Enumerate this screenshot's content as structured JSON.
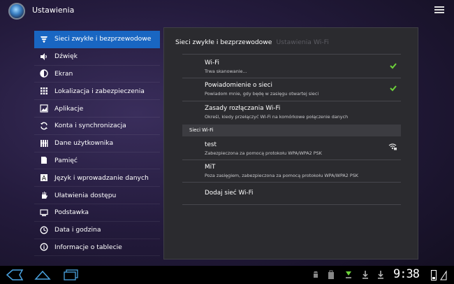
{
  "app": {
    "title": "Ustawienia"
  },
  "sidebar": {
    "items": [
      {
        "label": "Sieci zwykłe i bezprzewodowe",
        "icon": "wifi-icon",
        "active": true
      },
      {
        "label": "Dźwięk",
        "icon": "speaker-icon"
      },
      {
        "label": "Ekran",
        "icon": "brightness-icon"
      },
      {
        "label": "Lokalizacja i zabezpieczenia",
        "icon": "grid-lock-icon"
      },
      {
        "label": "Aplikacje",
        "icon": "apps-icon"
      },
      {
        "label": "Konta i synchronizacja",
        "icon": "sync-icon"
      },
      {
        "label": "Dane użytkownika",
        "icon": "data-icon"
      },
      {
        "label": "Pamięć",
        "icon": "storage-icon"
      },
      {
        "label": "Język i wprowadzanie danych",
        "icon": "language-icon"
      },
      {
        "label": "Ułatwienia dostępu",
        "icon": "hand-icon"
      },
      {
        "label": "Podstawka",
        "icon": "dock-icon"
      },
      {
        "label": "Data i godzina",
        "icon": "clock-icon"
      },
      {
        "label": "Informacje o tablecie",
        "icon": "info-icon"
      }
    ]
  },
  "panel": {
    "breadcrumb_active": "Sieci zwykłe i bezprzewodowe",
    "breadcrumb_inactive": "Ustawienia Wi-Fi",
    "wifi": {
      "title": "Wi-Fi",
      "subtitle": "Trwa skanowanie...",
      "checked": true
    },
    "notify": {
      "title": "Powiadomienie o sieci",
      "subtitle": "Powiadom mnie, gdy będę w zasięgu otwartej sieci",
      "checked": true
    },
    "sleep": {
      "title": "Zasady rozłączania Wi-Fi",
      "subtitle": "Określ, kiedy przełączyć Wi-Fi na komórkowe połączenie danych"
    },
    "section_header": "Sieci Wi-Fi",
    "networks": [
      {
        "name": "test",
        "status": "Zabezpieczona za pomocą protokołu WPA/WPA2 PSK"
      },
      {
        "name": "MiT",
        "status": "Poza zasięgiem, zabezpieczona za pomocą protokołu WPA/WPA2 PSK"
      }
    ],
    "add_network": "Dodaj sieć Wi-Fi"
  },
  "statusbar": {
    "clock": "9:38"
  },
  "colors": {
    "accent": "#1966c2",
    "check": "#6dd33a"
  }
}
